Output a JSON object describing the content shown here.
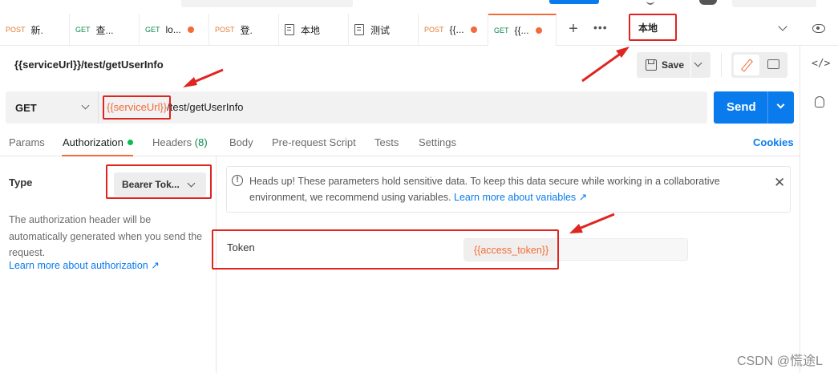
{
  "tabs": [
    {
      "method": "POST",
      "title": "新."
    },
    {
      "method": "GET",
      "title": "查..."
    },
    {
      "method": "GET",
      "title": "lo..."
    },
    {
      "method": "POST",
      "title": "登."
    },
    {
      "method": "",
      "title": "本地"
    },
    {
      "method": "",
      "title": "测试"
    },
    {
      "method": "POST",
      "title": "{{..."
    },
    {
      "method": "GET",
      "title": "{{..."
    }
  ],
  "environment": "本地",
  "request": {
    "title": "{{serviceUrl}}/test/getUserInfo",
    "method": "GET",
    "url_var": "{{serviceUrl}}",
    "url_rest": "/test/getUserInfo"
  },
  "toolbar": {
    "save_label": "Save",
    "send_label": "Send"
  },
  "request_tabs": {
    "params": "Params",
    "authorization": "Authorization",
    "headers": "Headers",
    "headers_count": "(8)",
    "body": "Body",
    "pre_request": "Pre-request Script",
    "tests": "Tests",
    "settings": "Settings",
    "cookies": "Cookies"
  },
  "auth": {
    "type_label": "Type",
    "type_value": "Bearer Tok...",
    "description": "The authorization header will be automatically generated when you send the request.",
    "learn_more": "Learn more about authorization ↗",
    "warning_text": "Heads up! These parameters hold sensitive data. To keep this data secure while working in a collaborative environment, we recommend using variables.",
    "warning_link": "Learn more about variables ↗",
    "token_label": "Token",
    "token_value": "{{access_token}}"
  },
  "watermark": "CSDN @慌途L",
  "colors": {
    "accent": "#f26b3a",
    "primary": "#097bed",
    "highlight": "#e0241f"
  }
}
